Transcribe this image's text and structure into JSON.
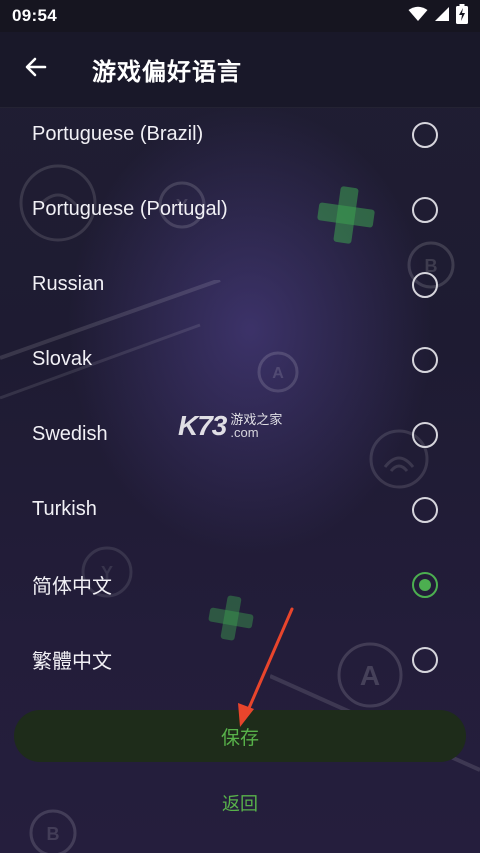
{
  "status_bar": {
    "time": "09:54",
    "icons": [
      "wifi-icon",
      "signal-icon",
      "battery-charging-icon"
    ]
  },
  "app_bar": {
    "back_icon": "arrow-left-icon",
    "title": "游戏偏好语言"
  },
  "languages": [
    {
      "label": "Portuguese (Brazil)",
      "selected": false
    },
    {
      "label": "Portuguese (Portugal)",
      "selected": false
    },
    {
      "label": "Russian",
      "selected": false
    },
    {
      "label": "Slovak",
      "selected": false
    },
    {
      "label": "Swedish",
      "selected": false
    },
    {
      "label": "Turkish",
      "selected": false
    },
    {
      "label": "简体中文",
      "selected": true
    },
    {
      "label": "繁體中文",
      "selected": false
    }
  ],
  "actions": {
    "save_label": "保存",
    "back_label": "返回"
  },
  "watermark": {
    "logo": "K73",
    "site_name": "游戏之家",
    "domain": ".com"
  },
  "colors": {
    "accent": "#4caf50",
    "button_text": "#58b24a",
    "button_bg": "#1e2c1a",
    "annotation_arrow": "#e8452c"
  }
}
